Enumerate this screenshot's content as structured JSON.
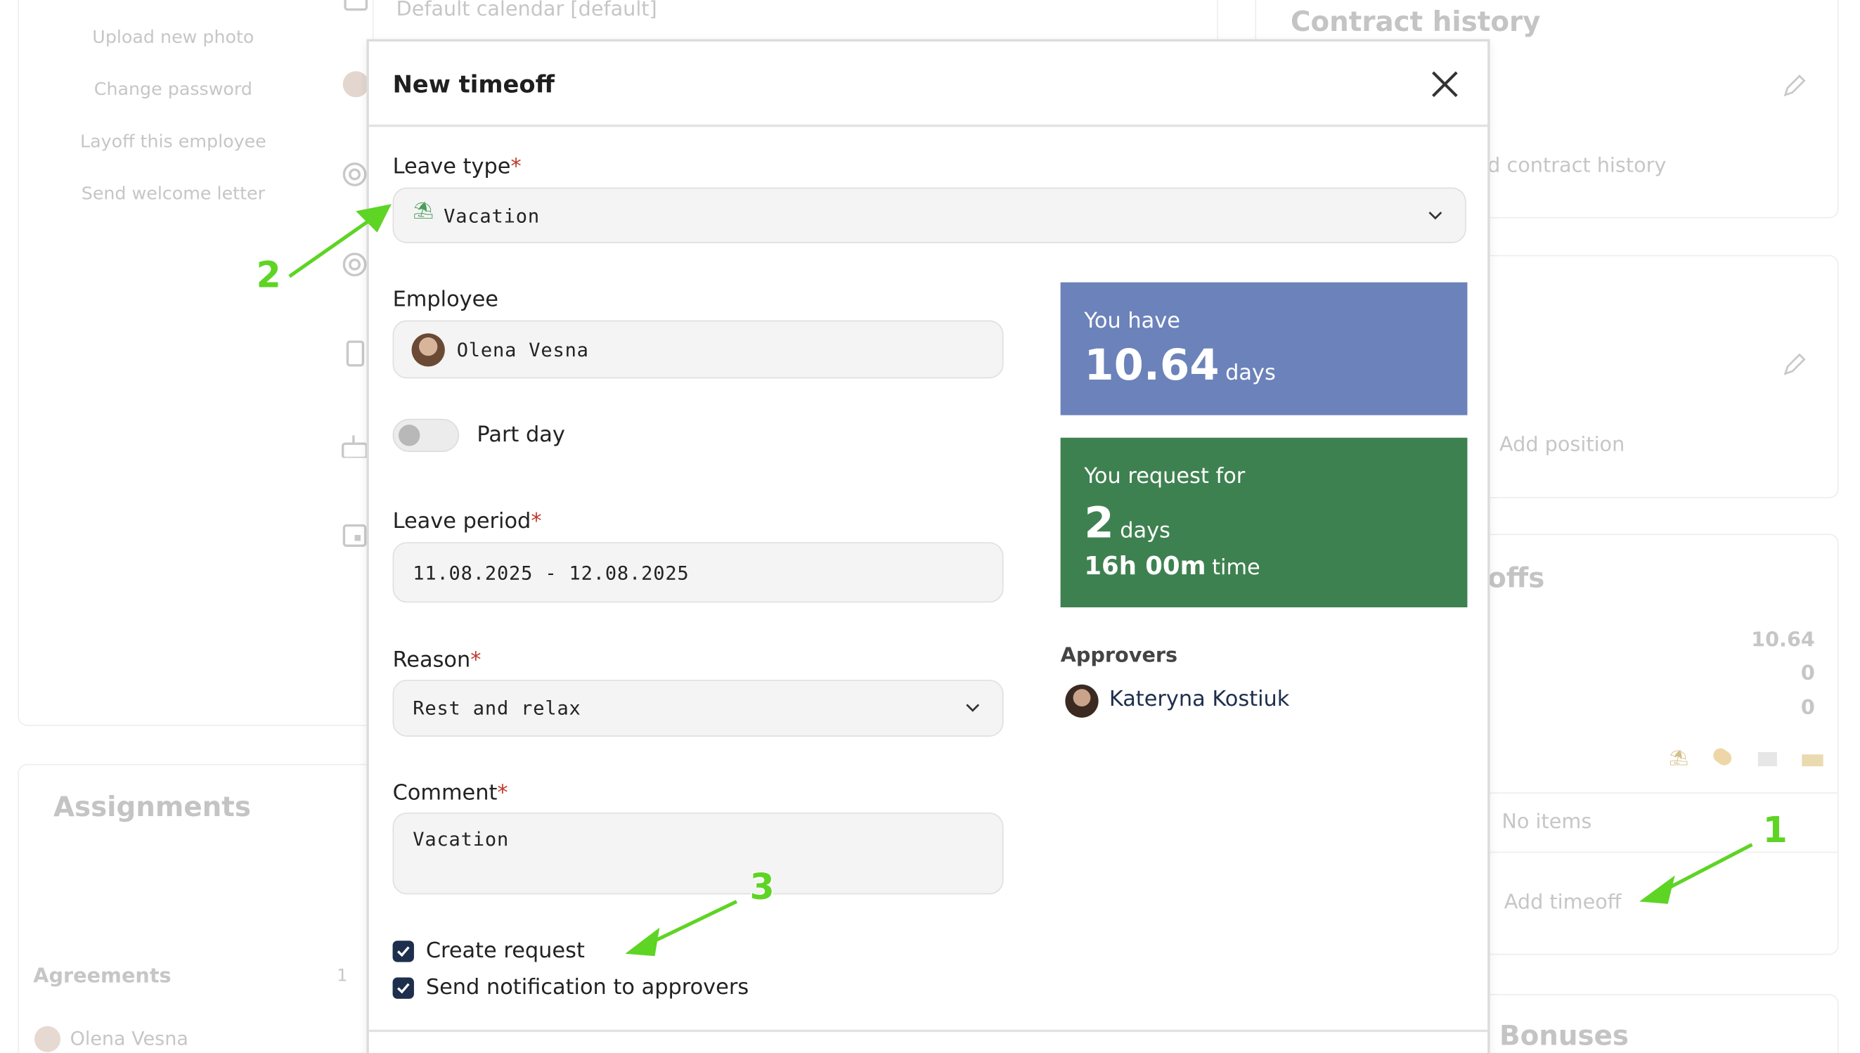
{
  "background": {
    "left_menu": [
      "Upload new photo",
      "Change password",
      "Layoff this employee",
      "Send welcome letter"
    ],
    "calendar_text": "Default calendar [default]",
    "assignments_title": "Assignments",
    "agreements_label": "Agreements",
    "agreements_count": "1",
    "agreements_person": "Olena Vesna",
    "contract_history_title": "Contract history",
    "add_contract_history": "d contract history",
    "add_position": "Add position",
    "timeoffs_title": "offs",
    "timeoff_values": [
      "10.64",
      "0",
      "0"
    ],
    "no_items": "No items",
    "add_timeoff": "Add timeoff",
    "bonuses_title": "Bonuses"
  },
  "modal": {
    "title": "New timeoff",
    "leave_type": {
      "label": "Leave type",
      "required_mark": "*",
      "value": "Vacation"
    },
    "employee": {
      "label": "Employee",
      "value": "Olena Vesna"
    },
    "part_day": {
      "label": "Part day",
      "enabled": false
    },
    "leave_period": {
      "label": "Leave period",
      "required_mark": "*",
      "value": "11.08.2025 - 12.08.2025"
    },
    "reason": {
      "label": "Reason",
      "required_mark": "*",
      "value": "Rest and relax"
    },
    "comment": {
      "label": "Comment",
      "required_mark": "*",
      "value": "Vacation"
    },
    "balance": {
      "caption": "You have",
      "amount": "10.64",
      "unit": "days",
      "color": "#6b82ba"
    },
    "request": {
      "caption": "You request for",
      "days_amount": "2",
      "days_unit": "days",
      "time_amount": "16h 00m",
      "time_unit": "time",
      "color": "#3e8150"
    },
    "approvers": {
      "label": "Approvers",
      "names": [
        "Kateryna Kostiuk"
      ]
    },
    "checkboxes": [
      {
        "label": "Create request",
        "checked": true
      },
      {
        "label": "Send notification to approvers",
        "checked": true
      }
    ]
  },
  "annotations": [
    "1",
    "2",
    "3"
  ],
  "colors": {
    "annotation": "#5ed424",
    "checkbox": "#1d2f4d",
    "required": "#c0392b"
  }
}
